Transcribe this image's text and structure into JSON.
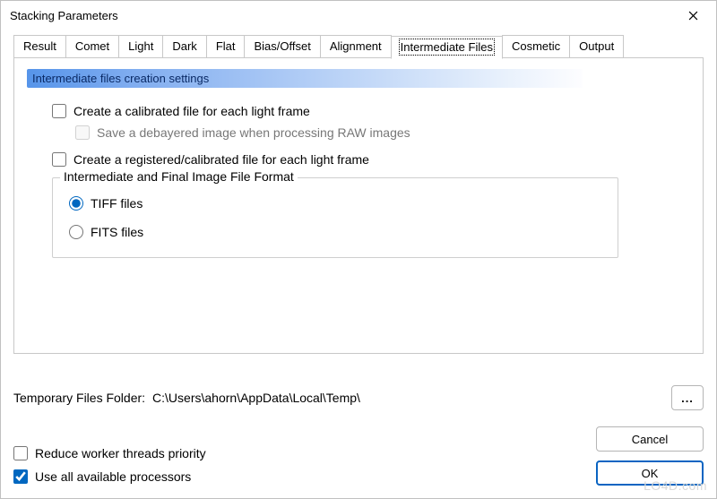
{
  "window": {
    "title": "Stacking Parameters"
  },
  "tabs": [
    "Result",
    "Comet",
    "Light",
    "Dark",
    "Flat",
    "Bias/Offset",
    "Alignment",
    "Intermediate Files",
    "Cosmetic",
    "Output"
  ],
  "active_tab_index": 7,
  "section": {
    "header": "Intermediate files creation settings",
    "opt_calibrated": "Create a calibrated file for each light frame",
    "opt_debayer": "Save a debayered image when processing RAW images",
    "opt_registered": "Create a registered/calibrated file for each light frame",
    "group_legend": "Intermediate and Final Image File Format",
    "radio_tiff": "TIFF files",
    "radio_fits": "FITS files"
  },
  "folder": {
    "label": "Temporary Files Folder:",
    "path": "C:\\Users\\ahorn\\AppData\\Local\\Temp\\",
    "browse": "..."
  },
  "bottom": {
    "reduce_priority": "Reduce worker threads priority",
    "use_all_procs": "Use all available processors",
    "cancel": "Cancel",
    "ok": "OK"
  },
  "state": {
    "calibrated_checked": false,
    "debayer_enabled": false,
    "debayer_checked": false,
    "registered_checked": false,
    "format_selected": "tiff",
    "reduce_priority_checked": false,
    "use_all_procs_checked": true
  },
  "watermark": "LO4D.com"
}
